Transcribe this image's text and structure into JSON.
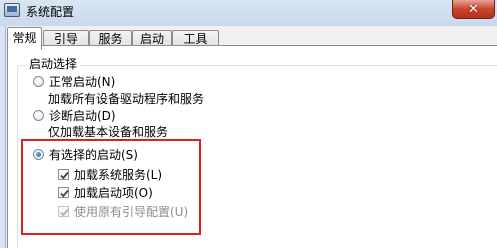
{
  "window": {
    "title": "系统配置",
    "close_label": "✕"
  },
  "tabs": [
    {
      "label": "常规",
      "active": true
    },
    {
      "label": "引导",
      "active": false
    },
    {
      "label": "服务",
      "active": false
    },
    {
      "label": "启动",
      "active": false
    },
    {
      "label": "工具",
      "active": false
    }
  ],
  "startup_selection": {
    "legend": "启动选择",
    "normal": {
      "label": "正常启动(N)",
      "description": "加载所有设备驱动程序和服务",
      "selected": false
    },
    "diagnostic": {
      "label": "诊断启动(D)",
      "description": "仅加载基本设备和服务",
      "selected": false
    },
    "selective": {
      "label": "有选择的启动(S)",
      "selected": true,
      "options": {
        "load_services": {
          "label": "加载系统服务(L)",
          "checked": true,
          "enabled": true
        },
        "load_startup": {
          "label": "加载启动项(O)",
          "checked": true,
          "enabled": true
        },
        "use_original_boot": {
          "label": "使用原有引导配置(U)",
          "checked": true,
          "enabled": false
        }
      }
    }
  },
  "colors": {
    "annotation_box": "#e02020",
    "close_button": "#c9462c"
  }
}
